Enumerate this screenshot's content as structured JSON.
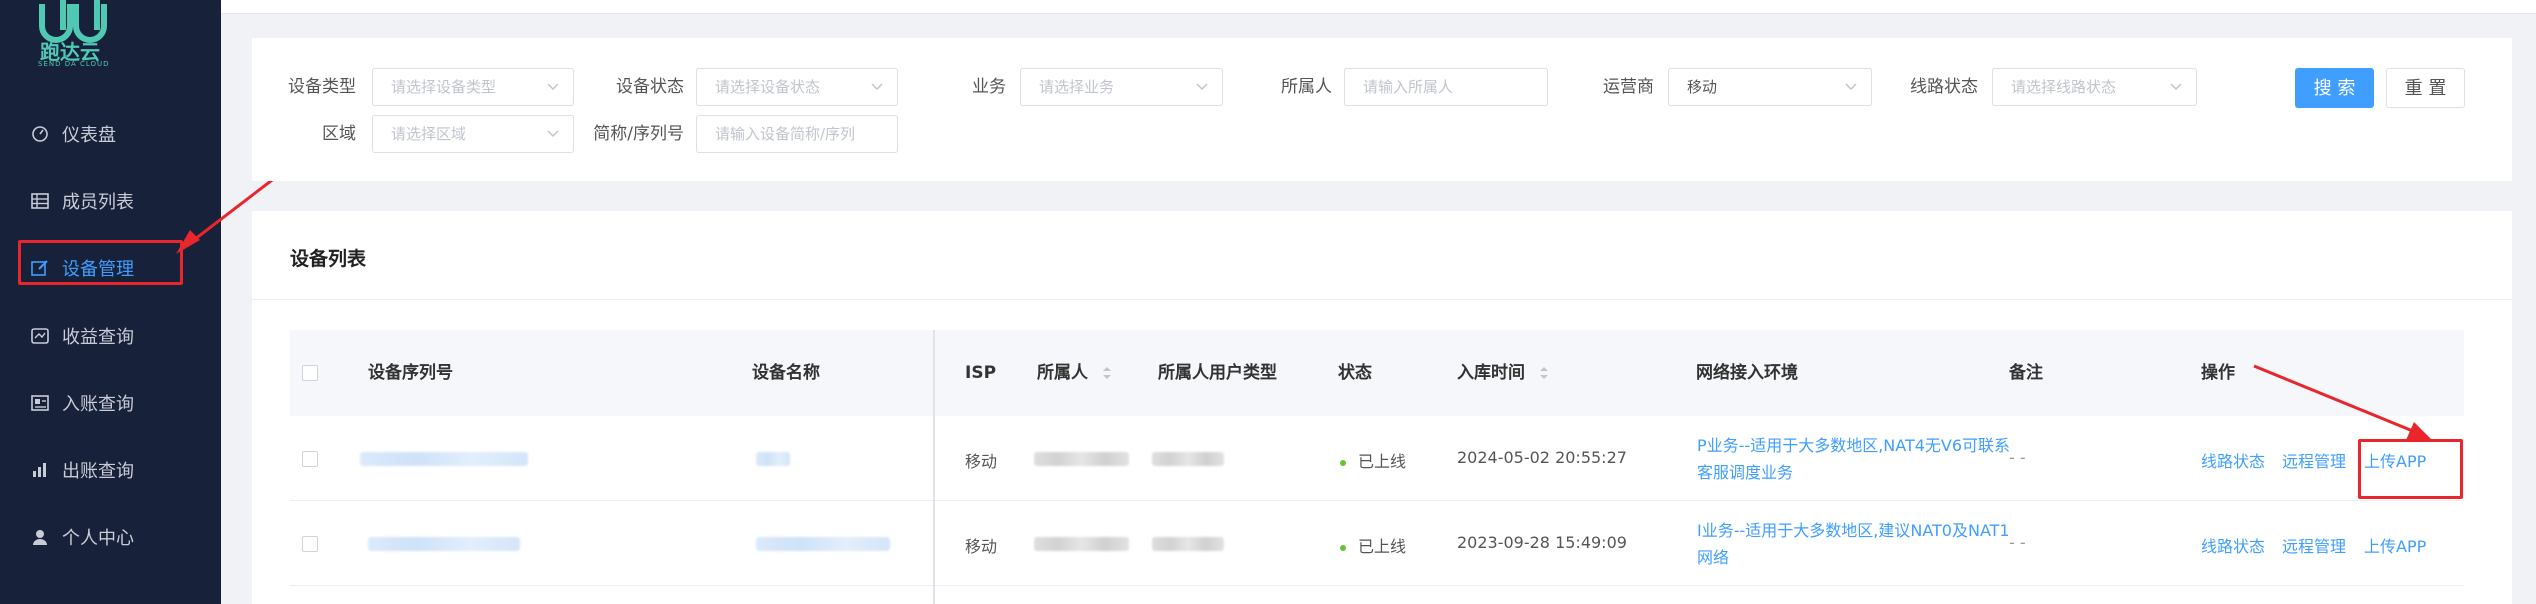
{
  "sidebar": {
    "logo_text": "跑达云",
    "logo_sub": "SEND DA CLOUD",
    "items": [
      {
        "label": "仪表盘",
        "icon": "dashboard-icon"
      },
      {
        "label": "成员列表",
        "icon": "table-icon"
      },
      {
        "label": "设备管理",
        "icon": "edit-icon",
        "active": true
      },
      {
        "label": "收益查询",
        "icon": "wallet-icon"
      },
      {
        "label": "入账查询",
        "icon": "ledger-icon"
      },
      {
        "label": "出账查询",
        "icon": "chart-icon"
      },
      {
        "label": "个人中心",
        "icon": "user-icon"
      }
    ]
  },
  "filters": {
    "device_type_label": "设备类型",
    "device_type_placeholder": "请选择设备类型",
    "device_status_label": "设备状态",
    "device_status_placeholder": "请选择设备状态",
    "business_label": "业务",
    "business_placeholder": "请选择业务",
    "owner_label": "所属人",
    "owner_placeholder": "请输入所属人",
    "operator_label": "运营商",
    "operator_value": "移动",
    "line_status_label": "线路状态",
    "line_status_placeholder": "请选择线路状态",
    "region_label": "区域",
    "region_placeholder": "请选择区域",
    "alias_label": "简称/序列号",
    "alias_placeholder": "请输入设备简称/序列",
    "search_label": "搜 索",
    "reset_label": "重 置"
  },
  "list": {
    "title": "设备列表",
    "columns": {
      "serial": "设备序列号",
      "name": "设备名称",
      "isp": "ISP",
      "owner": "所属人",
      "owner_type": "所属人用户类型",
      "status": "状态",
      "stock_time": "入库时间",
      "network": "网络接入环境",
      "remark": "备注",
      "actions": "操作"
    },
    "rows": [
      {
        "isp": "移动",
        "status": "已上线",
        "stock_time": "2024-05-02 20:55:27",
        "network": "P业务--适用于大多数地区,NAT4无V6可联系客服调度业务",
        "remark": "- -",
        "action_line": "线路状态",
        "action_remote": "远程管理",
        "action_upload": "上传APP"
      },
      {
        "isp": "移动",
        "status": "已上线",
        "stock_time": "2023-09-28 15:49:09",
        "network": "I业务--适用于大多数地区,建议NAT0及NAT1网络",
        "remark": "- -",
        "action_line": "线路状态",
        "action_remote": "远程管理",
        "action_upload": "上传APP"
      }
    ]
  },
  "colors": {
    "sidebar_bg": "#17213a",
    "primary": "#409eff",
    "annotation_red": "#e8262b",
    "status_online": "#67c23a"
  }
}
